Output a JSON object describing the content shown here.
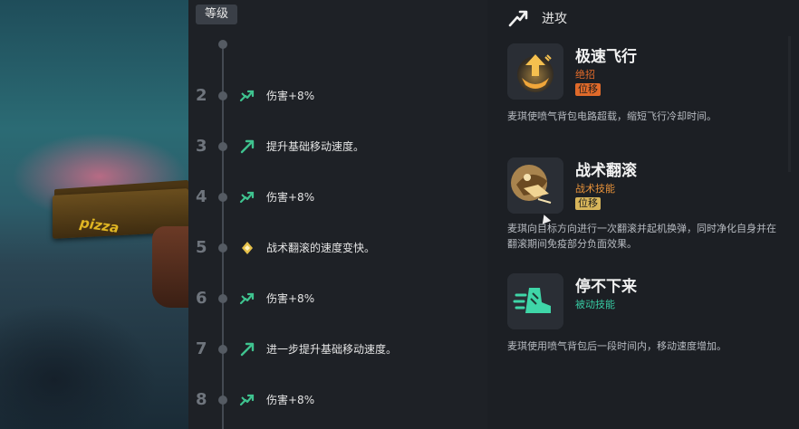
{
  "colors": {
    "accent_green": "#3fc38f",
    "ultimate_orange": "#e06a2a",
    "tactical_orange": "#e8923a",
    "passive_green": "#37c9a2",
    "tag_yellow_bg": "#d7b55a"
  },
  "level": {
    "tag_label": "等级",
    "rows": [
      {
        "num": "2",
        "icon": "attack-arrow-icon",
        "text": "伤害+8%"
      },
      {
        "num": "3",
        "icon": "speed-arrow-icon",
        "text": "提升基础移动速度。"
      },
      {
        "num": "4",
        "icon": "attack-arrow-icon",
        "text": "伤害+8%"
      },
      {
        "num": "5",
        "icon": "diamond-icon",
        "text": "战术翻滚的速度变快。"
      },
      {
        "num": "6",
        "icon": "attack-arrow-icon",
        "text": "伤害+8%"
      },
      {
        "num": "7",
        "icon": "speed-arrow-icon",
        "text": "进一步提升基础移动速度。"
      },
      {
        "num": "8",
        "icon": "attack-arrow-icon",
        "text": "伤害+8%"
      }
    ]
  },
  "attack": {
    "label": "进攻",
    "icon": "attack-trend-icon"
  },
  "skills": [
    {
      "name": "极速飞行",
      "type": "绝招",
      "tag": "位移",
      "icon": "jetpack-boost-icon",
      "desc": "麦琪使喷气背包电路超载，缩短飞行冷却时间。"
    },
    {
      "name": "战术翻滚",
      "type": "战术技能",
      "tag": "位移",
      "icon": "tactical-roll-icon",
      "desc": "麦琪向目标方向进行一次翻滚并起机换弹，同时净化自身并在翻滚期间免疫部分负面效果。"
    },
    {
      "name": "停不下来",
      "type": "被动技能",
      "tag": "",
      "icon": "unstoppable-boot-icon",
      "desc": "麦琪使用喷气背包后一段时间内，移动速度增加。"
    }
  ],
  "art": {
    "pizza_text": "pizza"
  }
}
